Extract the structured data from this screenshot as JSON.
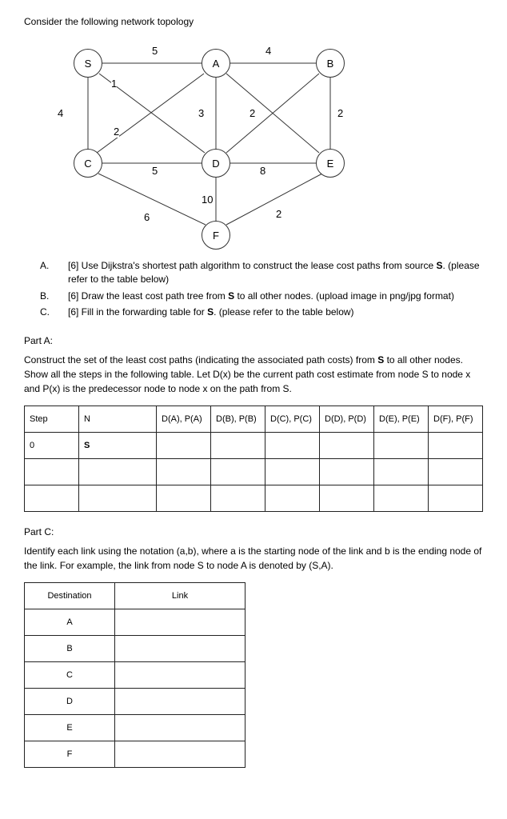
{
  "title": "Consider the following network topology",
  "graph": {
    "nodes": {
      "S": "S",
      "A": "A",
      "B": "B",
      "C": "C",
      "D": "D",
      "E": "E",
      "F": "F"
    },
    "labels": {
      "SA": "5",
      "SC_left": "4",
      "SC_diag": "1",
      "SD": "2",
      "AD": "3",
      "AB": "4",
      "AE": "2",
      "BE": "2",
      "CD": "5",
      "CF": "6",
      "DF": "10",
      "DE": "8",
      "EF": "2"
    }
  },
  "questions": {
    "a": "[6] Use Dijkstra's shortest path algorithm to construct the lease cost paths from source ",
    "a_bold": "S",
    "a_tail": ". (please refer to the table below)",
    "b": "[6] Draw the least cost path tree from ",
    "b_bold": "S",
    "b_tail": " to all other nodes. (upload image in png/jpg format)",
    "c": "[6] Fill in the forwarding table for ",
    "c_bold": "S",
    "c_tail": ". (please refer to the table below)"
  },
  "partA": {
    "head": "Part A:",
    "para1": "Construct the set of the least cost paths (indicating the associated path costs) from ",
    "para1_bold": "S",
    "para1_tail": " to all other nodes. Show all the steps in the following table. Let D(x) be the current path cost estimate from node S to node x and P(x) is the predecessor node to node x on the path from S.",
    "headers": [
      "Step",
      "N",
      "D(A), P(A)",
      "D(B), P(B)",
      "D(C), P(C)",
      "D(D), P(D)",
      "D(E), P(E)",
      "D(F), P(F)"
    ],
    "row0": {
      "step": "0",
      "n": "S"
    }
  },
  "partC": {
    "head": "Part C:",
    "para": "Identify each link using the notation (a,b), where a is the starting node of the link and b is the ending node of the link. For example, the link from node S to node A is denoted by (S,A).",
    "headers": [
      "Destination",
      "Link"
    ],
    "rows": [
      "A",
      "B",
      "C",
      "D",
      "E",
      "F"
    ]
  }
}
